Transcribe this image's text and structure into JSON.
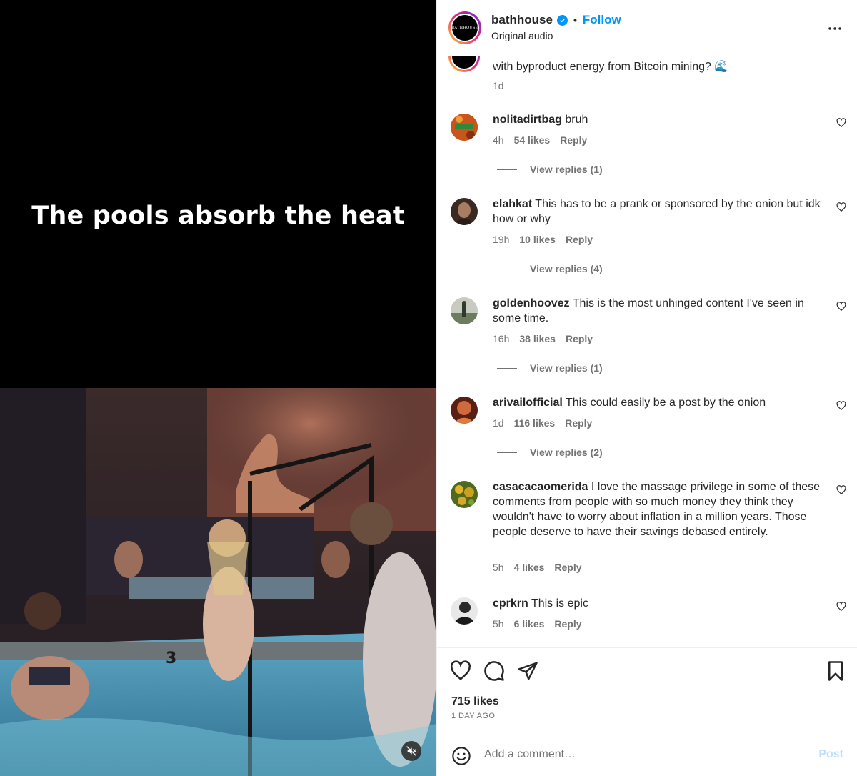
{
  "media": {
    "overlay_text": "The pools absorb the heat",
    "mute_icon": "speaker-muted-icon"
  },
  "header": {
    "avatar_text": "BATHHOUSE",
    "username": "bathhouse",
    "separator": "•",
    "follow_label": "Follow",
    "subtitle": "Original audio",
    "more_icon": "more-horizontal-icon"
  },
  "caption": {
    "text": "with byproduct energy from Bitcoin mining? 🌊",
    "time": "1d"
  },
  "comments": [
    {
      "user": "nolitadirtbag",
      "text": "bruh",
      "time": "4h",
      "likes": "54 likes",
      "reply": "Reply",
      "view_replies": "View replies (1)",
      "avatar_color": "#c9541c"
    },
    {
      "user": "elahkat",
      "text": "This has to be a prank or sponsored by the onion but idk how or why",
      "time": "19h",
      "likes": "10 likes",
      "reply": "Reply",
      "view_replies": "View replies (4)",
      "avatar_color": "#6b4a33"
    },
    {
      "user": "goldenhoovez",
      "text": "This is the most unhinged content I've seen in some time.",
      "time": "16h",
      "likes": "38 likes",
      "reply": "Reply",
      "view_replies": "View replies (1)",
      "avatar_color": "#8a9a7e"
    },
    {
      "user": "arivailofficial",
      "text": "This could easily be a post by the onion",
      "time": "1d",
      "likes": "116 likes",
      "reply": "Reply",
      "view_replies": "View replies (2)",
      "avatar_color": "#b2462c"
    },
    {
      "user": "casacacaomerida",
      "text": "I love the massage privilege in some of these comments from people with so much money they think they wouldn't have to worry about inflation in a million years. Those people deserve to have their savings debased entirely.",
      "time": "5h",
      "likes": "4 likes",
      "reply": "Reply",
      "avatar_color": "#8c9a2a"
    },
    {
      "user": "cprkrn",
      "text": "This is epic",
      "time": "5h",
      "likes": "6 likes",
      "reply": "Reply",
      "avatar_color": "#3a3a3a"
    }
  ],
  "actions": {
    "like_icon": "heart-icon",
    "comment_icon": "comment-bubble-icon",
    "share_icon": "paper-plane-icon",
    "save_icon": "bookmark-icon",
    "likes": "715 likes",
    "date": "1 DAY AGO"
  },
  "composer": {
    "emoji_icon": "emoji-smile-icon",
    "placeholder": "Add a comment…",
    "post_label": "Post"
  }
}
